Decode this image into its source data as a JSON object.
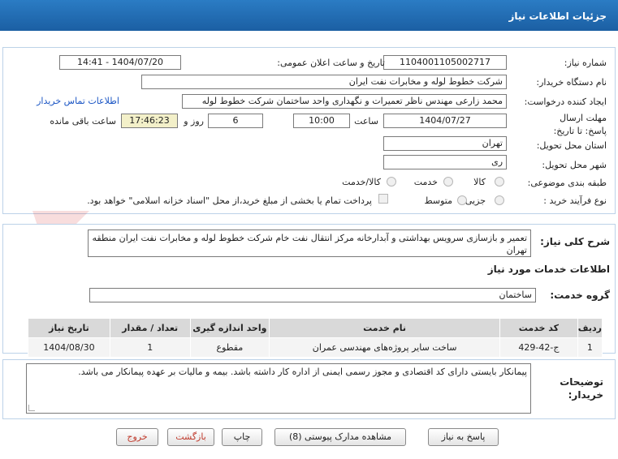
{
  "header": {
    "title": "جزئیات اطلاعات نیاز"
  },
  "form": {
    "need_number_label": "شماره نیاز:",
    "need_number": "1104001105002717",
    "announce_label": "تاریخ و ساعت اعلان عمومی:",
    "announce_value": "1404/07/20 - 14:41",
    "buyer_org_label": "نام دستگاه خریدار:",
    "buyer_org": "شرکت خطوط لوله و مخابرات نفت ایران",
    "creator_label": "ایجاد کننده درخواست:",
    "creator": "محمد  زارعی مهندس ناظر تعمیرات و نگهداری واحد ساختمان شرکت خطوط لوله",
    "contact_link": "اطلاعات تماس خریدار",
    "deadline_label": "مهلت ارسال پاسخ: تا تاریخ:",
    "deadline_date": "1404/07/27",
    "time_label": "ساعت",
    "deadline_time": "10:00",
    "days_value": "6",
    "days_label": "روز و",
    "remaining_time": "17:46:23",
    "remaining_label": "ساعت باقی مانده",
    "province_label": "استان محل تحویل:",
    "province": "تهران",
    "city_label": "شهر محل تحویل:",
    "city": "ری",
    "category_label": "طبقه بندی موضوعی:",
    "category_options": [
      "کالا",
      "خدمت",
      "کالا/خدمت"
    ],
    "process_label": "نوع فرآیند خرید :",
    "process_options": [
      "جزیی",
      "متوسط"
    ],
    "payment_note": "پرداخت تمام یا بخشی از مبلغ خرید،از محل \"اسناد خزانه اسلامی\" خواهد بود."
  },
  "summary": {
    "label": "شرح کلی نیاز:",
    "text": "تعمیر و بازسازی سرویس بهداشتی و آبدارخانه مرکز انتقال نفت خام شرکت خطوط لوله و مخابرات نفت ایران منطقه تهران"
  },
  "services": {
    "section_title": "اطلاعات خدمات مورد نیاز",
    "group_label": "گروه خدمت:",
    "group_value": "ساختمان",
    "columns": [
      "ردیف",
      "کد خدمت",
      "نام خدمت",
      "واحد اندازه گیری",
      "تعداد / مقدار",
      "تاریخ نیاز"
    ],
    "rows": [
      [
        "1",
        "ج-42-429",
        "ساخت سایر پروژه‌های مهندسی عمران",
        "مقطوع",
        "1",
        "1404/08/30"
      ]
    ]
  },
  "notes": {
    "label": "توضیحات خریدار:",
    "text": "پیمانکار بایستی دارای کد اقتصادی و مجوز رسمی ایمنی از اداره کار داشته باشد. بیمه و مالیات بر عهده پیمانکار می باشد."
  },
  "buttons": {
    "reply": "پاسخ به نیاز",
    "docs": "مشاهده مدارک پیوستی (8)",
    "print": "چاپ",
    "back": "بازگشت",
    "exit": "خروج"
  },
  "watermark_text": "AriaTender.net"
}
